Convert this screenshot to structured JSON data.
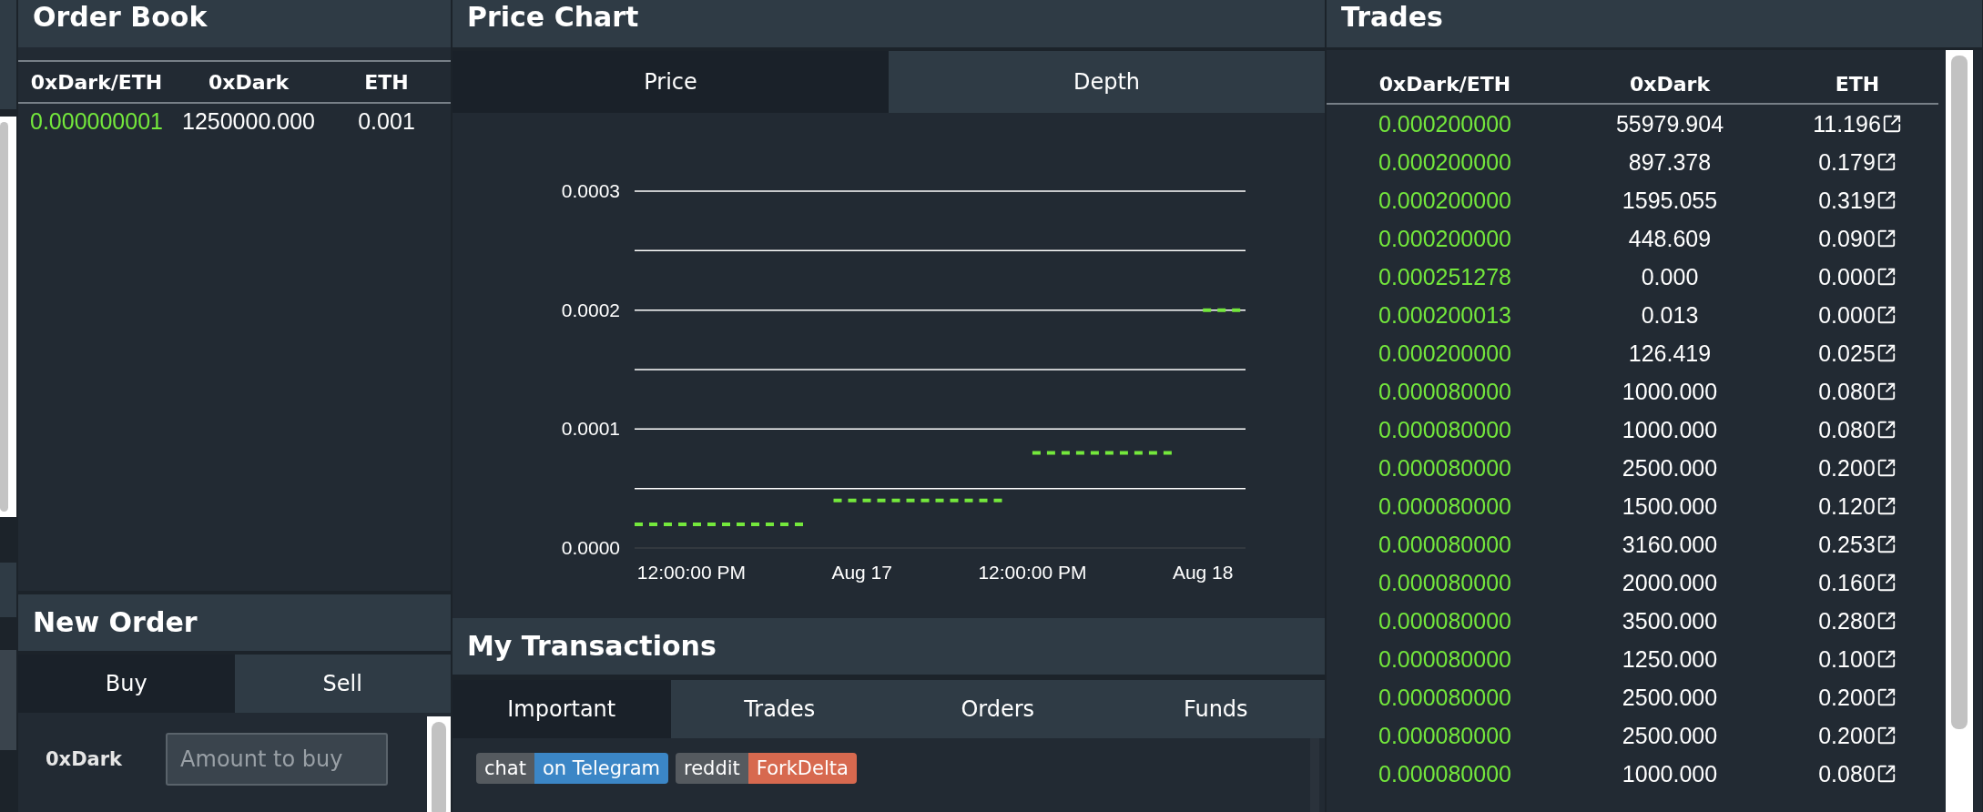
{
  "order_book": {
    "title": "Order Book",
    "columns": [
      "0xDark/ETH",
      "0xDark",
      "ETH"
    ],
    "rows": [
      {
        "price": "0.000000001",
        "amount": "1250000.000",
        "total": "0.001"
      }
    ]
  },
  "new_order": {
    "title": "New Order",
    "tabs": [
      {
        "label": "Buy",
        "selected": true
      },
      {
        "label": "Sell",
        "selected": false
      }
    ],
    "fields": [
      {
        "label": "0xDark",
        "placeholder": "Amount to buy"
      }
    ]
  },
  "price_chart": {
    "title": "Price Chart",
    "tabs": [
      {
        "label": "Price",
        "selected": true
      },
      {
        "label": "Depth",
        "selected": false
      }
    ],
    "chart_data": {
      "type": "line",
      "ylim": [
        0,
        0.0003
      ],
      "categories": [
        null,
        null,
        null,
        null,
        "12:00:00 PM",
        null,
        null,
        null,
        null,
        null,
        null,
        null,
        null,
        null,
        null,
        null,
        "Aug 17",
        null,
        null,
        null,
        null,
        null,
        null,
        null,
        null,
        null,
        null,
        null,
        "12:00:00 PM",
        null,
        null,
        null,
        null,
        null,
        null,
        null,
        null,
        null,
        null,
        null,
        "Aug 18",
        null,
        null,
        null
      ],
      "yticks": [
        {
          "value": 0,
          "label": "0.0000"
        },
        {
          "value": 0.0001,
          "label": "0.0001"
        },
        {
          "value": 0.0002,
          "label": "0.0002"
        },
        {
          "value": 0.0003,
          "label": "0.0003"
        }
      ],
      "series": [
        {
          "color": "#74e83c",
          "line_style": "dashed",
          "values": [
            2e-05,
            2e-05,
            2e-05,
            2e-05,
            2e-05,
            2e-05,
            2e-05,
            2e-05,
            2e-05,
            2e-05,
            2e-05,
            2e-05,
            2e-05,
            null,
            4e-05,
            4e-05,
            4e-05,
            4e-05,
            4e-05,
            4e-05,
            4e-05,
            4e-05,
            4e-05,
            4e-05,
            4e-05,
            4e-05,
            4e-05,
            null,
            8e-05,
            8e-05,
            8e-05,
            8e-05,
            8e-05,
            8e-05,
            8e-05,
            8e-05,
            8e-05,
            8e-05,
            8e-05,
            null,
            0.0002,
            0.0002,
            0.0002,
            0.0002
          ]
        }
      ]
    }
  },
  "my_transactions": {
    "title": "My Transactions",
    "tabs": [
      {
        "label": "Important",
        "selected": true
      },
      {
        "label": "Trades",
        "selected": false
      },
      {
        "label": "Orders",
        "selected": false
      },
      {
        "label": "Funds",
        "selected": false
      }
    ],
    "badges": [
      {
        "label": "chat",
        "message": "on Telegram",
        "color": "#3b86c6"
      },
      {
        "label": "reddit",
        "message": "ForkDelta",
        "color": "#d7694f"
      }
    ]
  },
  "trades": {
    "title": "Trades",
    "columns": [
      "0xDark/ETH",
      "0xDark",
      "ETH"
    ],
    "rows": [
      {
        "price": "0.000200000",
        "amount": "55979.904",
        "total": "11.196"
      },
      {
        "price": "0.000200000",
        "amount": "897.378",
        "total": "0.179"
      },
      {
        "price": "0.000200000",
        "amount": "1595.055",
        "total": "0.319"
      },
      {
        "price": "0.000200000",
        "amount": "448.609",
        "total": "0.090"
      },
      {
        "price": "0.000251278",
        "amount": "0.000",
        "total": "0.000"
      },
      {
        "price": "0.000200013",
        "amount": "0.013",
        "total": "0.000"
      },
      {
        "price": "0.000200000",
        "amount": "126.419",
        "total": "0.025"
      },
      {
        "price": "0.000080000",
        "amount": "1000.000",
        "total": "0.080"
      },
      {
        "price": "0.000080000",
        "amount": "1000.000",
        "total": "0.080"
      },
      {
        "price": "0.000080000",
        "amount": "2500.000",
        "total": "0.200"
      },
      {
        "price": "0.000080000",
        "amount": "1500.000",
        "total": "0.120"
      },
      {
        "price": "0.000080000",
        "amount": "3160.000",
        "total": "0.253"
      },
      {
        "price": "0.000080000",
        "amount": "2000.000",
        "total": "0.160"
      },
      {
        "price": "0.000080000",
        "amount": "3500.000",
        "total": "0.280"
      },
      {
        "price": "0.000080000",
        "amount": "1250.000",
        "total": "0.100"
      },
      {
        "price": "0.000080000",
        "amount": "2500.000",
        "total": "0.200"
      },
      {
        "price": "0.000080000",
        "amount": "2500.000",
        "total": "0.200"
      },
      {
        "price": "0.000080000",
        "amount": "1000.000",
        "total": "0.080"
      }
    ]
  }
}
